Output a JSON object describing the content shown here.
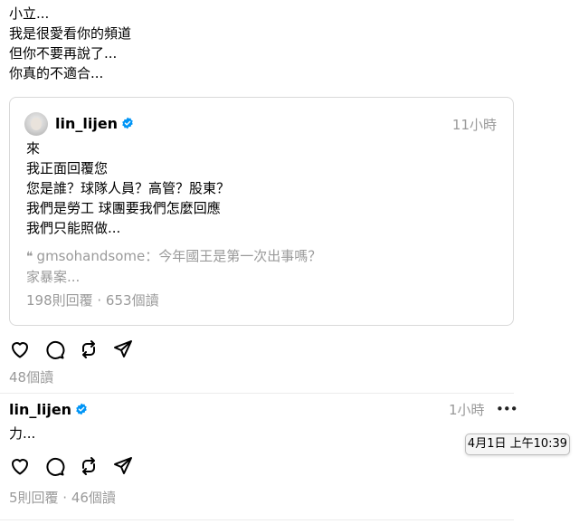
{
  "top_post": {
    "lines": [
      "小立...",
      "我是很愛看你的頻道",
      "但你不要再說了...",
      "你真的不適合..."
    ],
    "views": "48個讀"
  },
  "quoted_post": {
    "username": "lin_lijen",
    "time": "11小時",
    "lines": [
      "來",
      "我正面回覆您",
      "您是誰？球隊人員？高管？股東？",
      "我們是勞工 球團要我們怎麼回應",
      "我們只能照做..."
    ],
    "reply_preview_line1": "gmsohandsome：今年國王是第一次出事嗎？",
    "reply_preview_line2": "家暴案...",
    "stats": "198則回覆 · 653個讀"
  },
  "reply_post": {
    "username": "lin_lijen",
    "time": "1小時",
    "text": "力...",
    "tooltip": "4月1日 上午10:39",
    "stats": "5則回覆 · 46個讀"
  },
  "icons": {
    "like": "heart-icon",
    "comment": "comment-bubble-icon",
    "repost": "repost-icon",
    "share": "send-icon",
    "verified": "verified-badge-icon",
    "more": "more-dots-icon",
    "quote": "quote-mark-icon"
  },
  "colors": {
    "verified_blue": "#0095f6",
    "secondary_text": "#999999"
  }
}
